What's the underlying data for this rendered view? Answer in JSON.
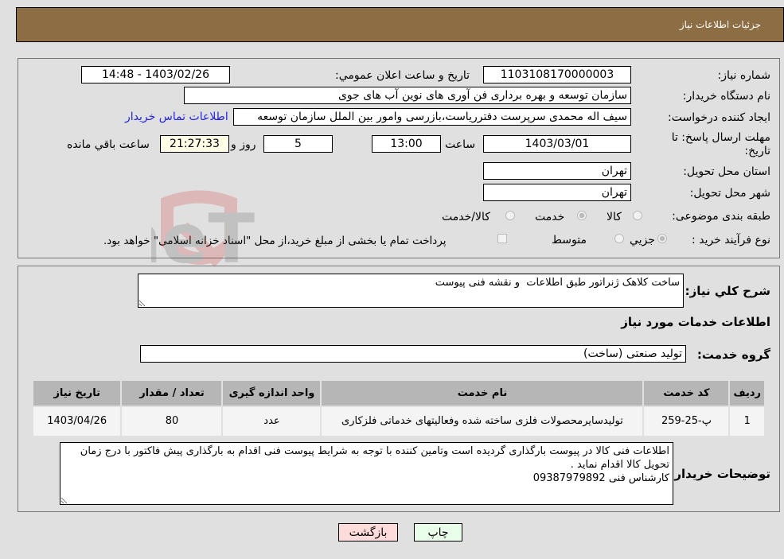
{
  "header": {
    "title": "جزئیات اطلاعات نیاز"
  },
  "form": {
    "need_number": {
      "label": "شماره نیاز:",
      "value": "1103108170000003"
    },
    "announce_datetime": {
      "label": "تاریخ و ساعت اعلان عمومي:",
      "value": "1403/02/26 - 14:48"
    },
    "buyer_org": {
      "label": "نام دستگاه خریدار:",
      "value": "سازمان توسعه و بهره برداری فن آوری های نوین آب های جوی"
    },
    "requester": {
      "label": "ایجاد کننده درخواست:",
      "value": "سیف اله محمدی سرپرست دفترریاست،بازرسی وامور بین الملل سازمان توسعه"
    },
    "buyer_contact_link": "اطلاعات تماس خریدار",
    "deadline": {
      "label": "مهلت ارسال پاسخ: تا تاریخ:",
      "date": "1403/03/01",
      "time_label": "ساعت",
      "time": "13:00",
      "days": "5",
      "days_label": "روز و",
      "remaining": "21:27:33",
      "remaining_label": "ساعت باقي مانده"
    },
    "province": {
      "label": "استان محل تحویل:",
      "value": "تهران"
    },
    "city": {
      "label": "شهر محل تحویل:",
      "value": "تهران"
    },
    "category": {
      "label": "طبقه بندی موضوعی:",
      "options": [
        "کالا",
        "خدمت",
        "کالا/خدمت"
      ],
      "selected": "خدمت"
    },
    "purchase_type": {
      "label": "نوع فرآیند خرید :",
      "options": [
        "جزیي",
        "متوسط"
      ],
      "selected": "جزیي",
      "payment_note": "پرداخت تمام یا بخشی از مبلغ خرید،از محل \"اسناد خزانه اسلامی\" خواهد بود."
    }
  },
  "details": {
    "description_label": "شرح کلي نیاز:",
    "description": "ساخت کلاهک ژنراتور طبق اطلاعات  و نقشه فنی پیوست",
    "services_heading": "اطلاعات خدمات مورد نیاز",
    "service_group_label": "گروه خدمت:",
    "service_group": "تولید صنعتی (ساخت)",
    "table": {
      "headers": [
        "ردیف",
        "کد خدمت",
        "نام خدمت",
        "واحد اندازه گیری",
        "تعداد / مقدار",
        "تاریخ نیاز"
      ],
      "rows": [
        [
          "1",
          "پ-25-259",
          "تولیدسایرمحصولات فلزی ساخته شده وفعالیتهای خدماتی فلزکاری",
          "عدد",
          "80",
          "1403/04/26"
        ]
      ]
    },
    "buyer_notes_label": "توضیحات خریدار:",
    "buyer_notes": "اطلاعات فنی کالا در پیوست بارگذاری گردیده است وتامین کننده با توجه به شرایط پیوست فنی اقدام به بارگذاری پیش فاکتور با درج زمان تحویل کالا اقدام نماید .\nکارشناس فنی 09387979892"
  },
  "buttons": {
    "print": "چاپ",
    "back": "بازگشت"
  },
  "watermark": "AriaTender.neT",
  "colors": {
    "header_bg": "#8d6d43",
    "link": "#2222dd",
    "print_bg": "#eaffea",
    "back_bg": "#ffdcdc"
  }
}
